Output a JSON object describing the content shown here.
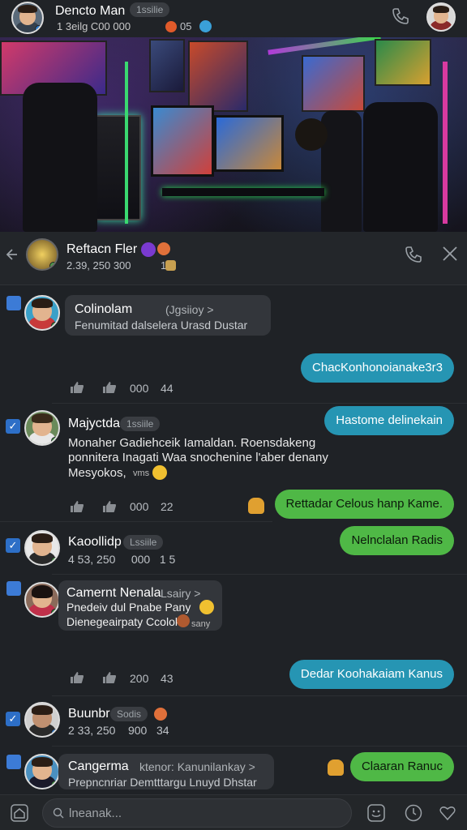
{
  "header": {
    "title": "Dencto Man",
    "tag": "1ssilie",
    "stats": "1 3eilg  C00     000",
    "stats2": "05"
  },
  "banner": {
    "alt": "gaming room photo"
  },
  "subheader": {
    "title": "Reftacn Fler",
    "stats": "2.39,  250     300",
    "stats2": "1"
  },
  "messages": [
    {
      "name": "Colinolam",
      "tag": "(Jgsiioy >",
      "text": "Fenumitad dalselera Urasd Dustar"
    },
    {
      "out": "ChacKonhonoianake3r3"
    },
    {
      "stats": [
        "000",
        "44"
      ]
    },
    {
      "name": "Majyctda",
      "tag": "1ssiile",
      "lines": [
        "Monaher Gadiehceik Iamaldan. Roensdakeng",
        "ponnitera Inagati Waa snochenine l'aber denany",
        "Mesyokos,"
      ],
      "end": "vms",
      "out": "Hastome delinekain"
    },
    {
      "stats": [
        "000",
        "22"
      ],
      "out": "Rettadar Celous hanp Kame."
    },
    {
      "out": "Nelnclalan Radis"
    },
    {
      "name": "Kaoollidp",
      "tag": "Lssiile",
      "stats": "4 53, 250     000   1 5"
    },
    {
      "name": "Camernt Nenala",
      "tag": "Lsairy >",
      "lines": [
        "Pnedeiv dul Pnabe Pany",
        "Dienegeairpaty Ccolok"
      ],
      "end": "sany"
    },
    {
      "stats": [
        "200",
        "43"
      ],
      "out": "Dedar Koohakaiam Kanus"
    },
    {
      "name": "Buunbr",
      "tag": "Sodis",
      "stats": "2 33, 250    900   34"
    },
    {
      "name": "Cangerma",
      "tag": "ktenor: Kanunilankay >",
      "text": "Prepncnriar Demtttargu Lnuyd Dhstar",
      "out": "Claaran Ranuc"
    }
  ],
  "composer": {
    "placeholder": "lneanak..."
  }
}
